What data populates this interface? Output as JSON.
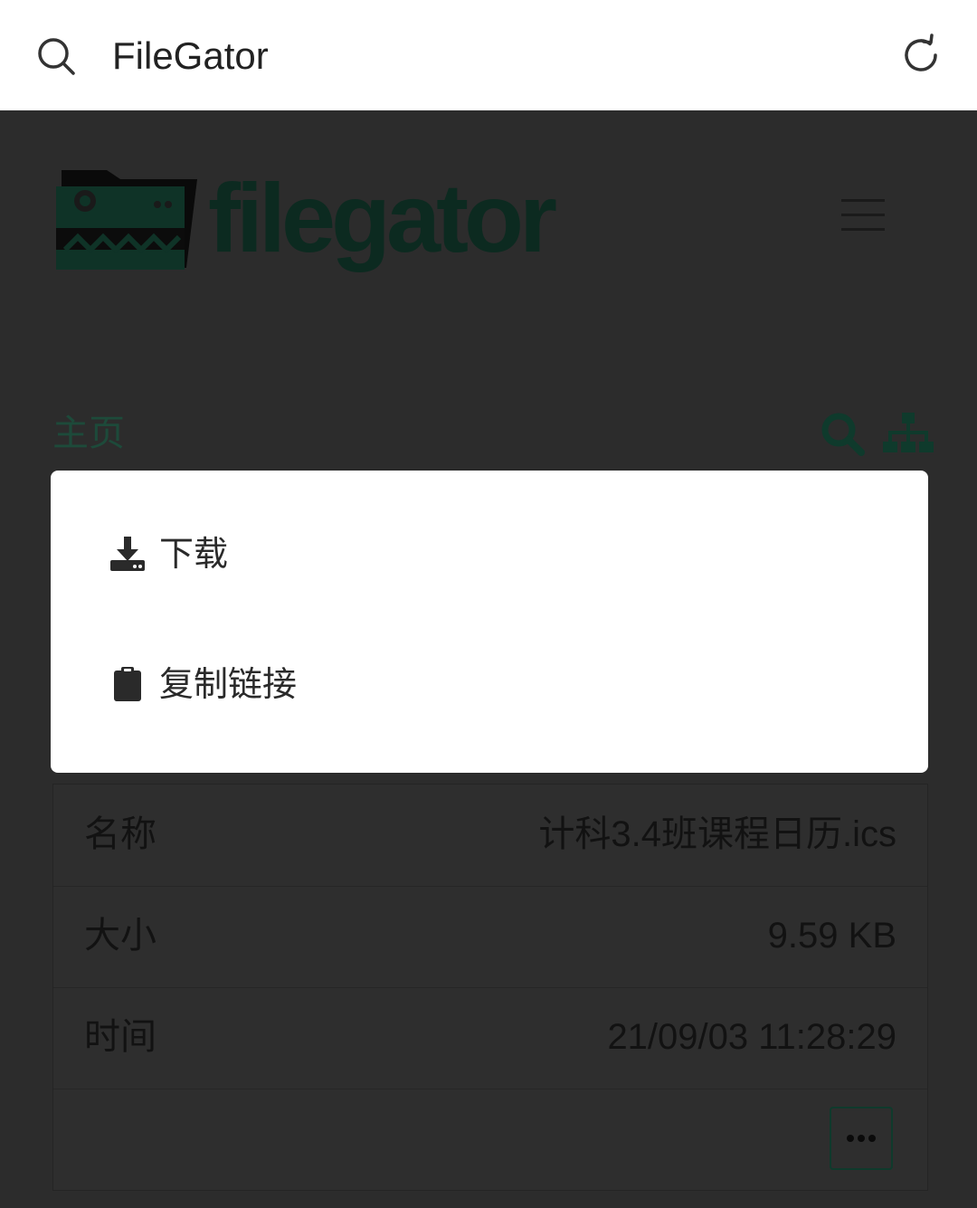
{
  "browser": {
    "title": "FileGator"
  },
  "header": {
    "logo_text": "filegator"
  },
  "breadcrumb": {
    "home": "主页"
  },
  "context_menu": {
    "items": [
      {
        "label": "下载",
        "icon": "download-icon"
      },
      {
        "label": "复制链接",
        "icon": "clipboard-icon"
      }
    ]
  },
  "file_info": {
    "rows": [
      {
        "key": "名称",
        "value": "计科3.4班课程日历.ics"
      },
      {
        "key": "大小",
        "value": "9.59 KB"
      },
      {
        "key": "时间",
        "value": "21/09/03 11:28:29"
      }
    ]
  },
  "colors": {
    "accent": "#1d4a3a",
    "overlay_bg": "#2c2c2c",
    "dialog_bg": "#ffffff"
  }
}
